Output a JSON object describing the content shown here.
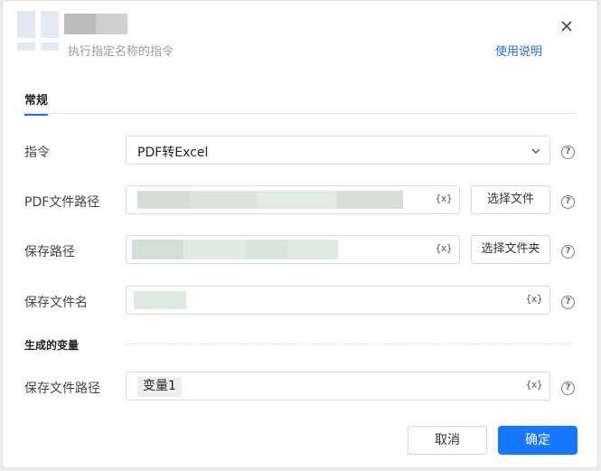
{
  "header": {
    "subtitle": "执行指定名称的指令",
    "help_link": "使用说明"
  },
  "tabs": [
    {
      "label": "常规",
      "active": true
    }
  ],
  "form": {
    "command": {
      "label": "指令",
      "value": "PDF转Excel"
    },
    "pdf_path": {
      "label": "PDF文件路径",
      "button": "选择文件",
      "fx": "{x}"
    },
    "save_path": {
      "label": "保存路径",
      "button": "选择文件夹",
      "fx": "{x}"
    },
    "save_filename": {
      "label": "保存文件名",
      "fx": "{x}"
    }
  },
  "generated_vars": {
    "section_title": "生成的变量",
    "output_path": {
      "label": "保存文件路径",
      "chip": "变量1",
      "fx": "{x}"
    }
  },
  "footer": {
    "cancel": "取消",
    "confirm": "确定"
  },
  "help_glyph": "?",
  "colors": {
    "primary": "#1677ff",
    "link": "#1f6fe0"
  }
}
